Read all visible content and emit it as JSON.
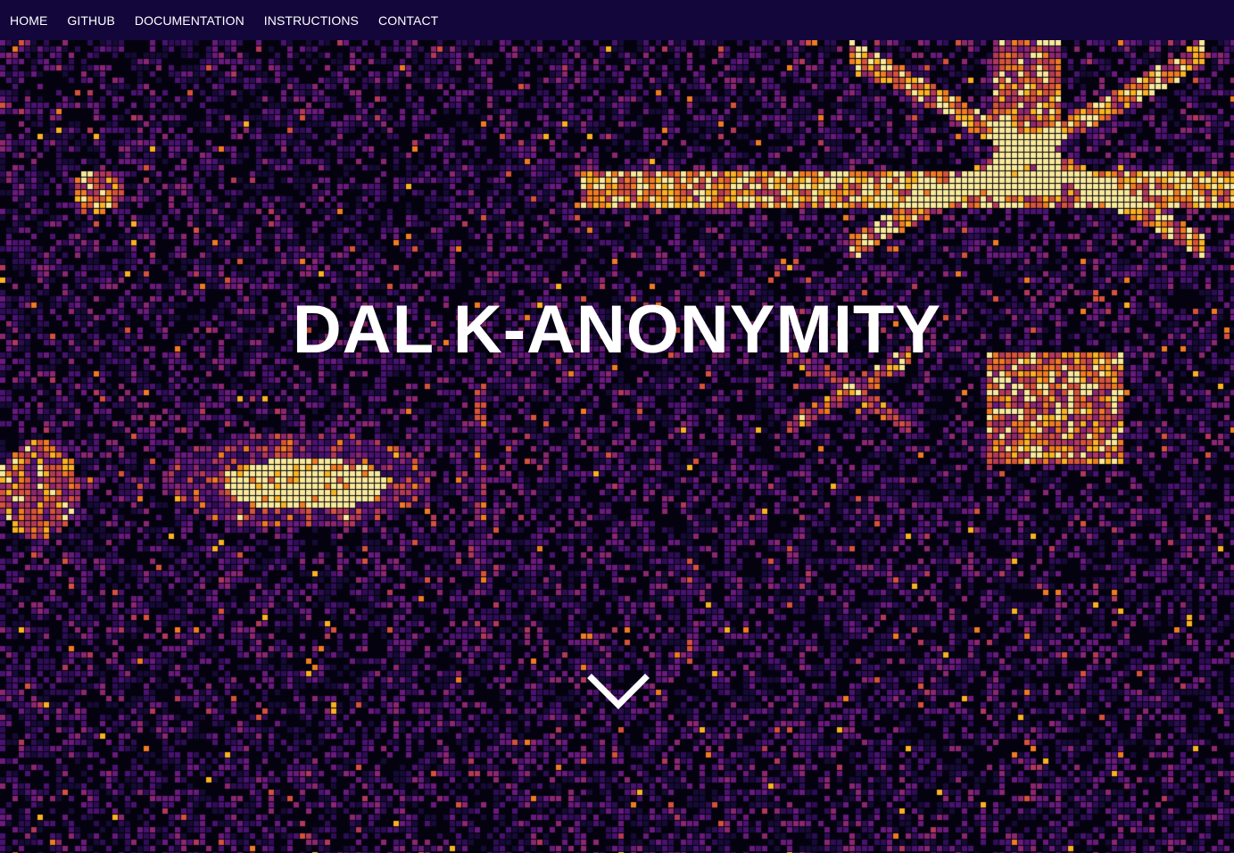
{
  "nav": {
    "items": [
      {
        "label": "HOME"
      },
      {
        "label": "GITHUB"
      },
      {
        "label": "DOCUMENTATION"
      },
      {
        "label": "INSTRUCTIONS"
      },
      {
        "label": "CONTACT"
      }
    ]
  },
  "hero": {
    "title": "DAL K-ANONYMITY",
    "background": "pixel-heatmap-inferno",
    "scroll_icon": "chevron-down-icon"
  },
  "colors": {
    "navbar": "#12063a",
    "text": "#ffffff",
    "heat_low": "#0b0420",
    "heat_mid": "#5c1a8a",
    "heat_high": "#f7e89a"
  }
}
